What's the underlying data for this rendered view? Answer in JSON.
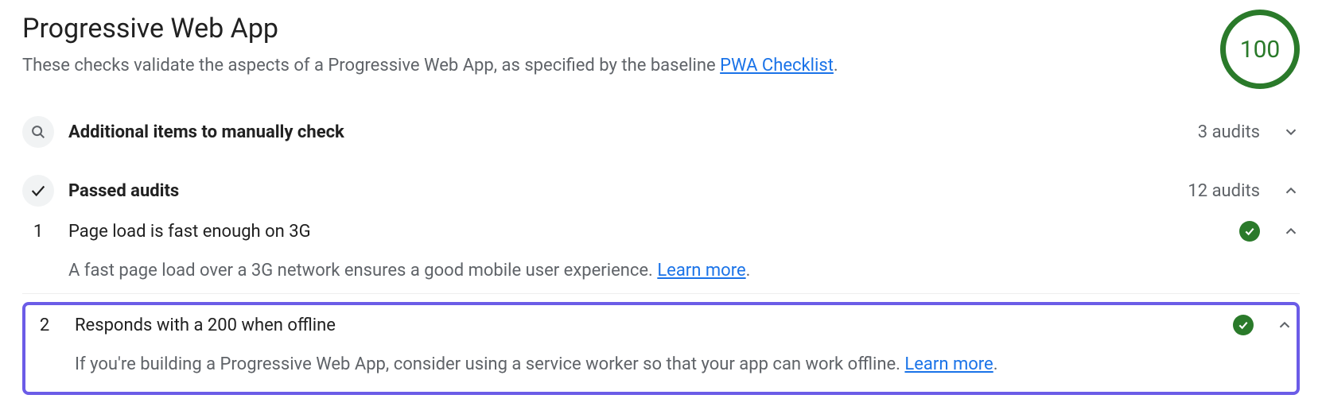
{
  "header": {
    "title": "Progressive Web App",
    "subtitle_prefix": "These checks validate the aspects of a Progressive Web App, as specified by the baseline ",
    "subtitle_link": "PWA Checklist",
    "subtitle_suffix": ".",
    "score": "100"
  },
  "groups": {
    "manual": {
      "title": "Additional items to manually check",
      "count": "3 audits",
      "expanded": false
    },
    "passed": {
      "title": "Passed audits",
      "count": "12 audits",
      "expanded": true
    }
  },
  "audits": [
    {
      "index": "1",
      "title": "Page load is fast enough on 3G",
      "description_prefix": "A fast page load over a 3G network ensures a good mobile user experience. ",
      "learn_more": "Learn more",
      "description_suffix": ".",
      "highlighted": false
    },
    {
      "index": "2",
      "title": "Responds with a 200 when offline",
      "description_prefix": "If you're building a Progressive Web App, consider using a service worker so that your app can work offline. ",
      "learn_more": "Learn more",
      "description_suffix": ".",
      "highlighted": true
    }
  ]
}
